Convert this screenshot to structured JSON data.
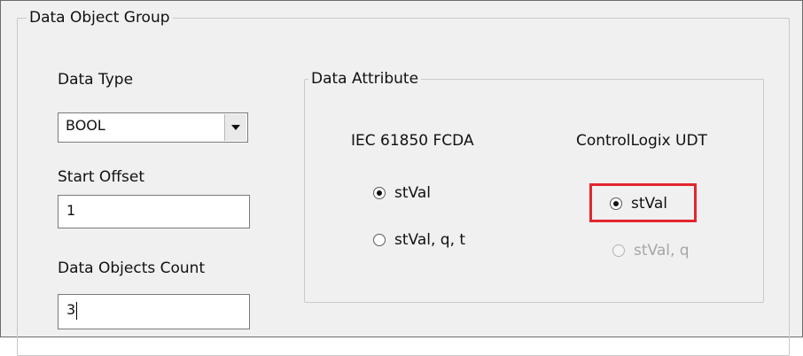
{
  "group": {
    "title": "Data Object Group"
  },
  "data_type": {
    "label": "Data Type",
    "selected": "BOOL"
  },
  "start_offset": {
    "label": "Start Offset",
    "value": "1"
  },
  "data_objects_count": {
    "label": "Data Objects Count",
    "value": "3"
  },
  "data_attribute": {
    "title": "Data Attribute",
    "fcda": {
      "heading": "IEC 61850 FCDA",
      "options": [
        {
          "label": "stVal",
          "checked": true,
          "enabled": true
        },
        {
          "label": "stVal, q, t",
          "checked": false,
          "enabled": true
        }
      ]
    },
    "udt": {
      "heading": "ControlLogix UDT",
      "options": [
        {
          "label": "stVal",
          "checked": true,
          "enabled": true
        },
        {
          "label": "stVal, q",
          "checked": false,
          "enabled": false
        }
      ]
    }
  },
  "colors": {
    "highlight": "#e3262d",
    "window_bg": "#f0f0f0",
    "disabled_text": "#a6a6a6"
  },
  "icons": {
    "dropdown": "triangle-down-icon"
  }
}
